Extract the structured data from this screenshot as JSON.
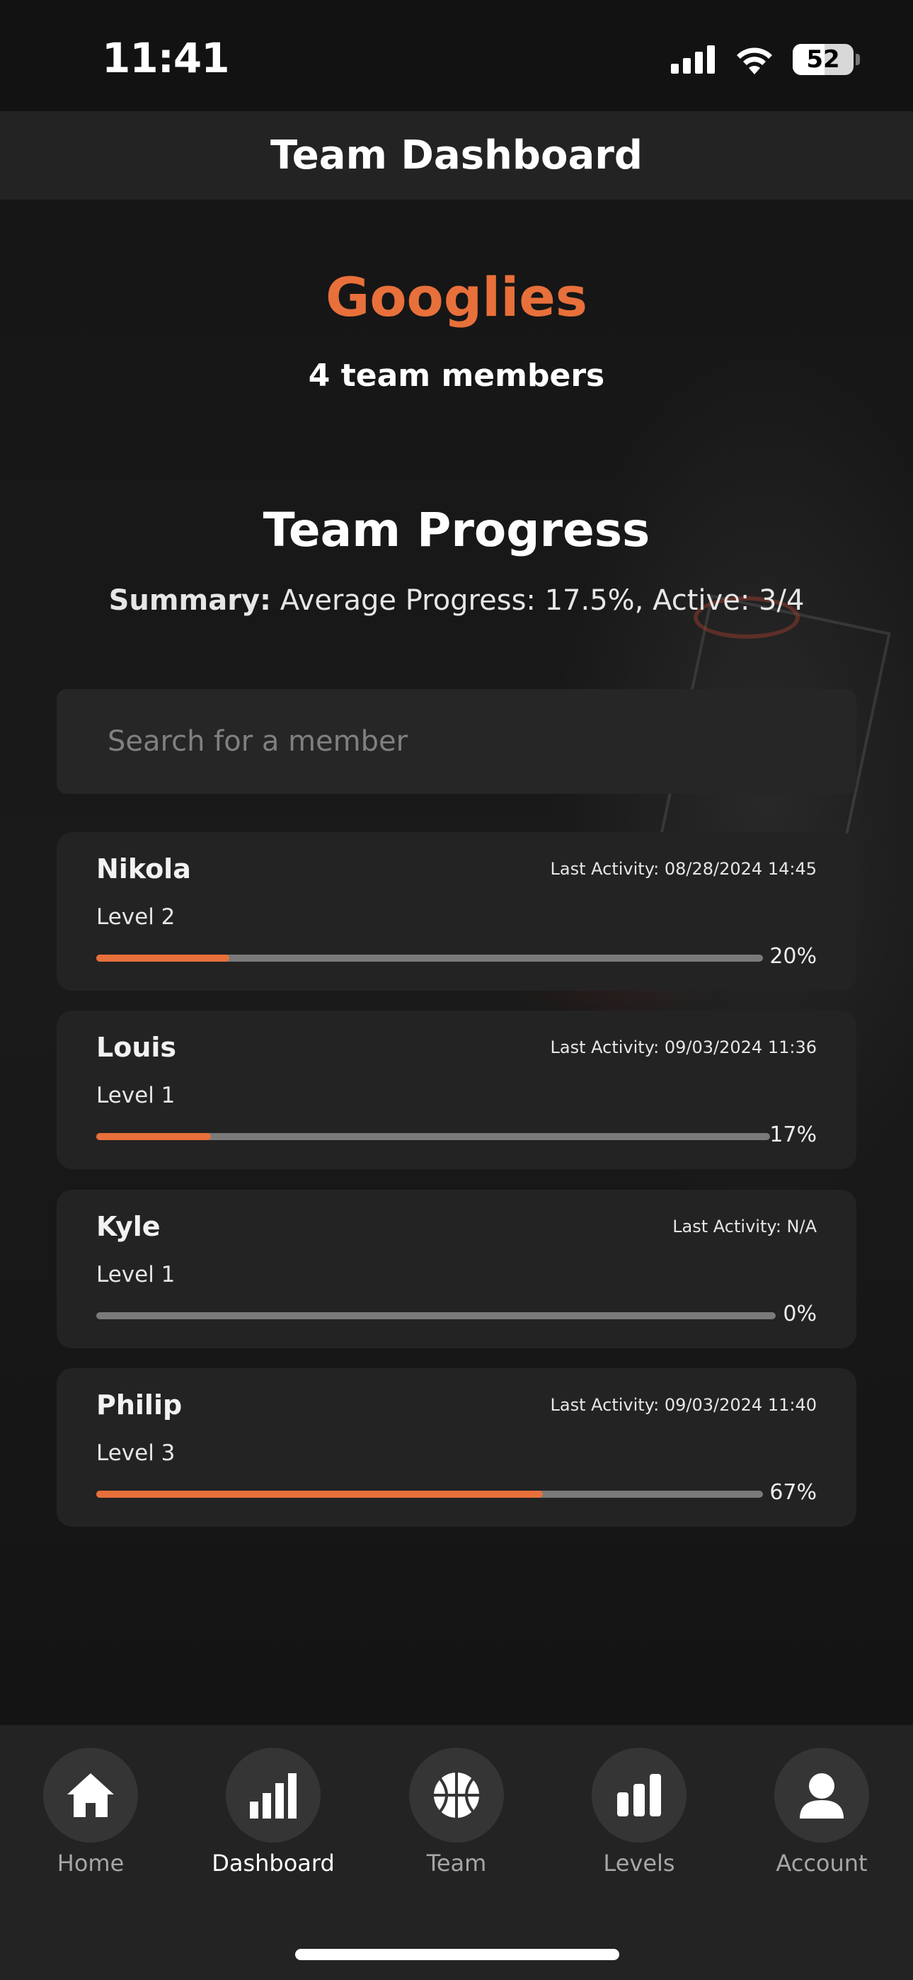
{
  "status": {
    "time": "11:41",
    "battery": "52"
  },
  "header": {
    "title": "Team Dashboard"
  },
  "team": {
    "name": "Googlies",
    "member_count": "4 team members"
  },
  "progress": {
    "title": "Team Progress",
    "summary_label": "Summary:",
    "summary_text": " Average Progress: 17.5%, Active: 3/4"
  },
  "search": {
    "placeholder": "Search for a member"
  },
  "members": [
    {
      "name": "Nikola",
      "activity": "Last Activity: 08/28/2024 14:45",
      "level": "Level 2",
      "percent_label": "20%",
      "progress": 0.2
    },
    {
      "name": "Louis",
      "activity": "Last Activity: 09/03/2024 11:36",
      "level": "Level 1",
      "percent_label": "17%",
      "progress": 0.17
    },
    {
      "name": "Kyle",
      "activity": "Last Activity: N/A",
      "level": "Level 1",
      "percent_label": "0%",
      "progress": 0.0
    },
    {
      "name": "Philip",
      "activity": "Last Activity: 09/03/2024 11:40",
      "level": "Level 3",
      "percent_label": "67%",
      "progress": 0.67
    }
  ],
  "tabs": [
    {
      "label": "Home",
      "icon": "home-icon"
    },
    {
      "label": "Dashboard",
      "icon": "bar-chart-icon",
      "active": true
    },
    {
      "label": "Team",
      "icon": "basketball-icon"
    },
    {
      "label": "Levels",
      "icon": "levels-icon"
    },
    {
      "label": "Account",
      "icon": "account-icon"
    }
  ],
  "colors": {
    "accent": "#e8703a",
    "background": "#121212",
    "card": "#232323"
  }
}
